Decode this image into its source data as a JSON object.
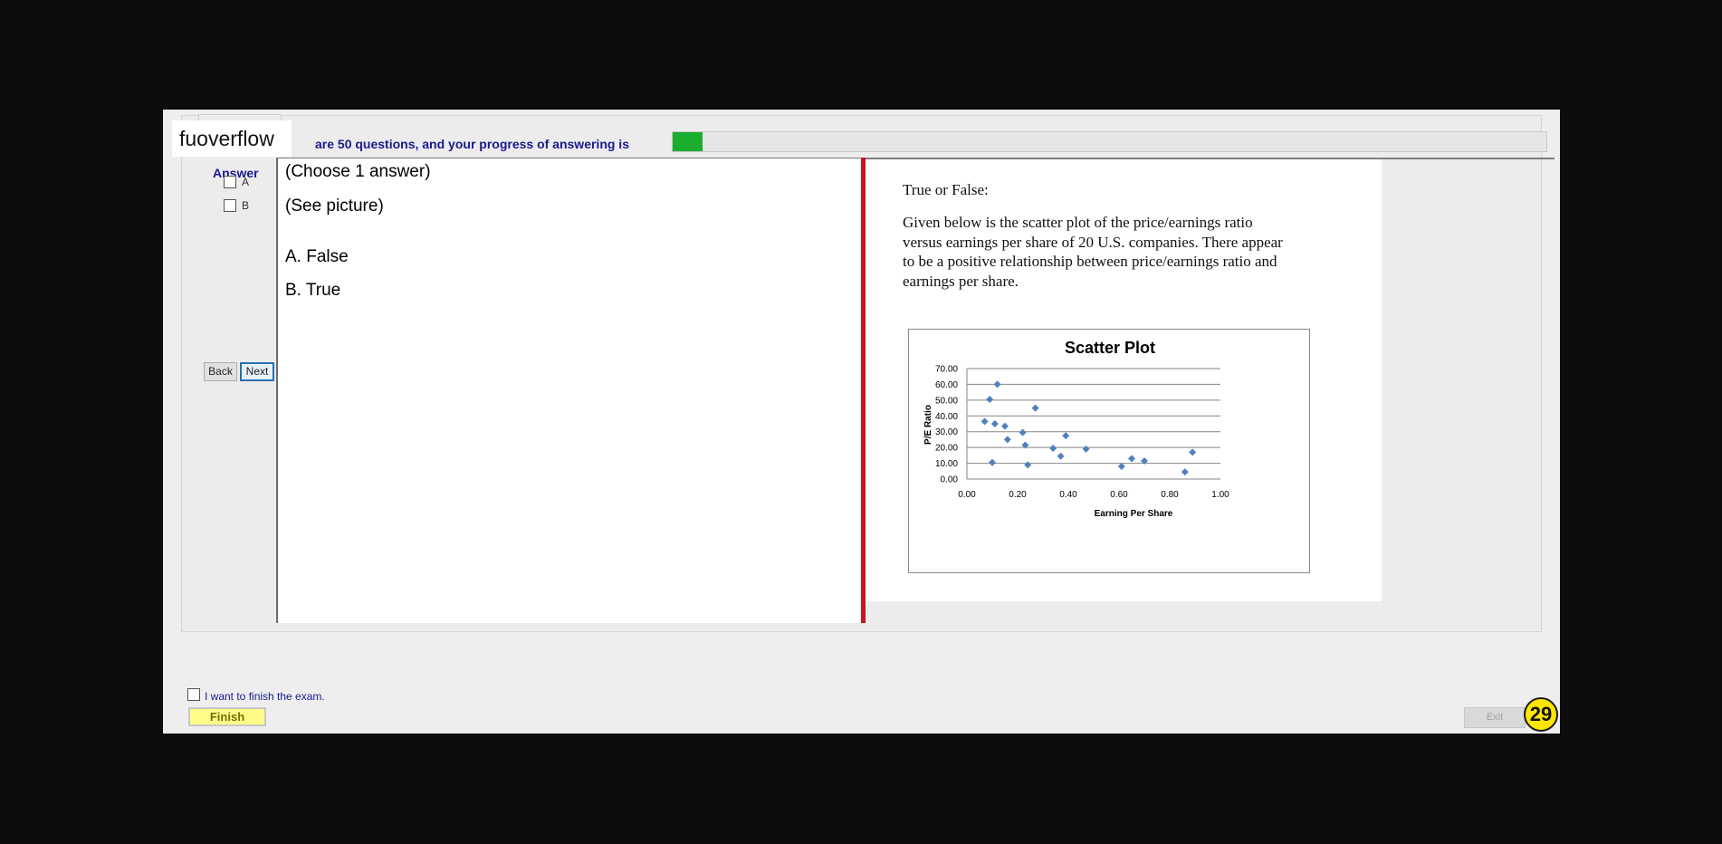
{
  "brand": {
    "name": "fuoverflow"
  },
  "header": {
    "progress_text": "are 50 questions, and your progress of answering is",
    "progress_fraction": 0.034,
    "progress_color": "#1aad2e"
  },
  "answer": {
    "title": "Answer",
    "options": [
      {
        "label": "A",
        "checked": false
      },
      {
        "label": "B",
        "checked": false
      }
    ]
  },
  "nav": {
    "back_label": "Back",
    "next_label": "Next"
  },
  "question": {
    "lines": [
      "(Choose 1 answer)",
      "(See picture)",
      "A.  False",
      "B.  True"
    ]
  },
  "picture": {
    "heading": "True or False:",
    "body_lines": [
      "Given below is the scatter  plot of the price/earnings ratio",
      "versus earnings per share of 20 U.S. companies.  There appear",
      "to be a positive relationship between price/earnings ratio and",
      "earnings per share."
    ]
  },
  "chart_data": {
    "type": "scatter",
    "title": "Scatter Plot",
    "xlabel": "Earning Per Share",
    "ylabel": "P/E Ratio",
    "xlim": [
      0,
      1
    ],
    "ylim": [
      0,
      70
    ],
    "x_ticks": [
      "0.00",
      "0.20",
      "0.40",
      "0.60",
      "0.80",
      "1.00"
    ],
    "y_ticks": [
      "0.00",
      "10.00",
      "20.00",
      "30.00",
      "40.00",
      "50.00",
      "60.00",
      "70.00"
    ],
    "grid": true,
    "marker_color": "#4f81bd",
    "points": [
      {
        "x": 0.07,
        "y": 36.5
      },
      {
        "x": 0.09,
        "y": 50.5
      },
      {
        "x": 0.1,
        "y": 10.5
      },
      {
        "x": 0.11,
        "y": 35.0
      },
      {
        "x": 0.12,
        "y": 60.0
      },
      {
        "x": 0.15,
        "y": 33.5
      },
      {
        "x": 0.16,
        "y": 25.0
      },
      {
        "x": 0.22,
        "y": 29.5
      },
      {
        "x": 0.23,
        "y": 21.5
      },
      {
        "x": 0.24,
        "y": 9.0
      },
      {
        "x": 0.27,
        "y": 45.0
      },
      {
        "x": 0.34,
        "y": 19.5
      },
      {
        "x": 0.37,
        "y": 14.5
      },
      {
        "x": 0.39,
        "y": 27.5
      },
      {
        "x": 0.47,
        "y": 19.0
      },
      {
        "x": 0.61,
        "y": 8.0
      },
      {
        "x": 0.65,
        "y": 13.0
      },
      {
        "x": 0.7,
        "y": 11.5
      },
      {
        "x": 0.86,
        "y": 4.5
      },
      {
        "x": 0.89,
        "y": 17.0
      }
    ]
  },
  "footer": {
    "finish_checkbox_label": "I want to finish the exam.",
    "finish_label": "Finish",
    "exit_label": "Exit",
    "badge_number": "29"
  }
}
